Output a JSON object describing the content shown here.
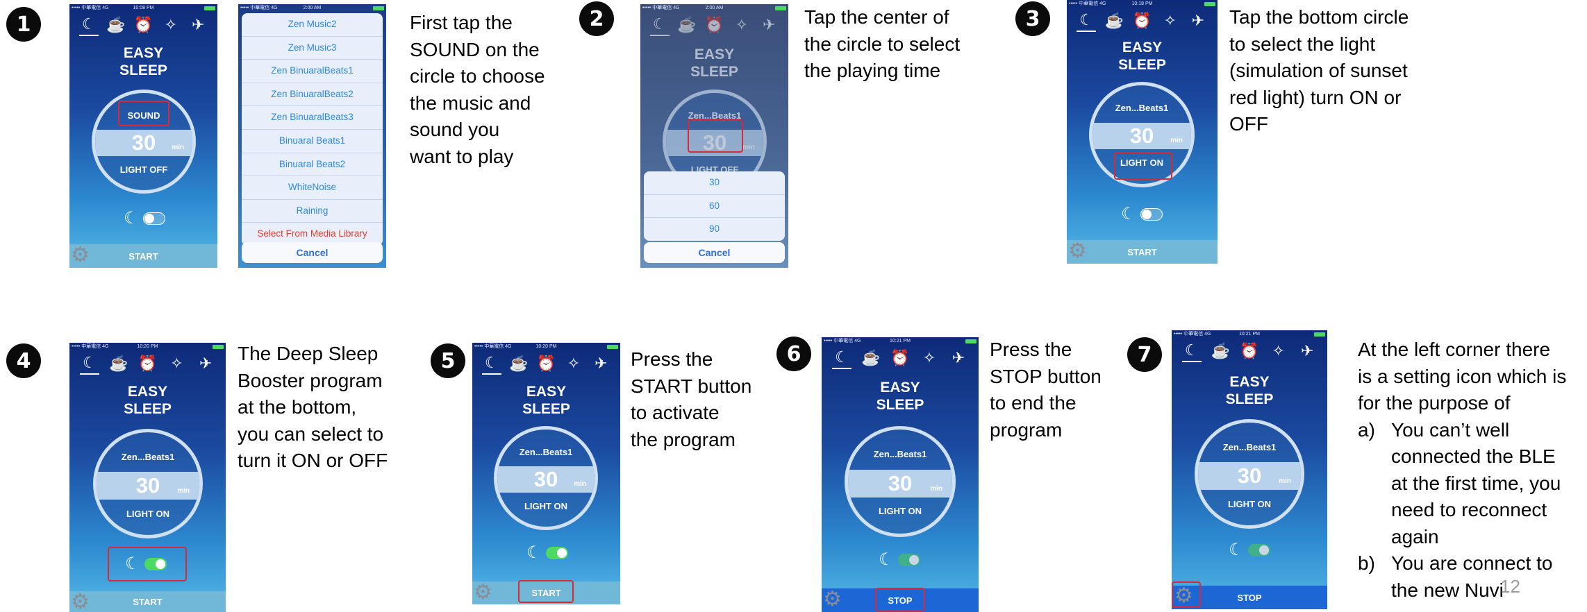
{
  "steps": [
    {
      "number": "1",
      "text": [
        "First tap the",
        "SOUND on the",
        "circle to choose",
        "the music and",
        "sound you",
        "want to play"
      ]
    },
    {
      "number": "2",
      "text": [
        "Tap the center of",
        "the circle to select",
        "the playing time"
      ]
    },
    {
      "number": "3",
      "text": [
        "Tap the bottom circle",
        "to select the light",
        "(simulation of sunset",
        "red light) turn ON or",
        "OFF"
      ]
    },
    {
      "number": "4",
      "text": [
        "The Deep Sleep",
        "Booster program",
        "at the bottom,",
        "you can select to",
        "turn it ON or OFF"
      ]
    },
    {
      "number": "5",
      "text": [
        "Press the",
        "START button",
        "to activate",
        "the program"
      ]
    },
    {
      "number": "6",
      "text": [
        "Press the",
        "STOP button",
        "to end the",
        "program"
      ]
    },
    {
      "number": "7",
      "text": [
        "At the left corner there",
        "is a setting icon which is",
        "for the purpose of"
      ],
      "items": [
        {
          "marker": "a)",
          "lines": [
            "You can’t well",
            "connected the BLE",
            "at the first time, you",
            "need to reconnect",
            "again"
          ]
        },
        {
          "marker": "b)",
          "lines": [
            "You are connect to",
            "the new Nuvi"
          ]
        }
      ]
    }
  ],
  "app": {
    "title_line1": "EASY",
    "title_line2": "SLEEP",
    "tabs": [
      "☾",
      "☕",
      "⏰",
      "✧",
      "✈"
    ],
    "minutes": "30",
    "unit": "min",
    "sound_label": "SOUND",
    "track_short": "Zen...Beats1",
    "light_off": "LIGHT OFF",
    "light_on": "LIGHT ON",
    "start": "START",
    "stop": "STOP",
    "moon": "☾",
    "gear": "⚙",
    "status_carrier": "••••• 中華電信  4G",
    "times": [
      "10:08 PM",
      "2:00 AM",
      "2:00 AM",
      "10:18 PM",
      "10:20 PM",
      "10:20 PM",
      "10:21 PM",
      "10:21 PM"
    ]
  },
  "sound_menu": {
    "items": [
      "Zen Music2",
      "Zen Music3",
      "Zen BinuaralBeats1",
      "Zen BinuaralBeats2",
      "Zen BinuaralBeats3",
      "Binuaral Beats1",
      "Binuaral Beats2",
      "WhiteNoise",
      "Raining",
      "Select From Media Library"
    ],
    "cancel": "Cancel"
  },
  "time_menu": {
    "items": [
      "30",
      "60",
      "90"
    ],
    "cancel": "Cancel"
  },
  "page_number": "12",
  "colors": {
    "highlight": "#d42a3a",
    "badge": "#0b0b0b"
  }
}
